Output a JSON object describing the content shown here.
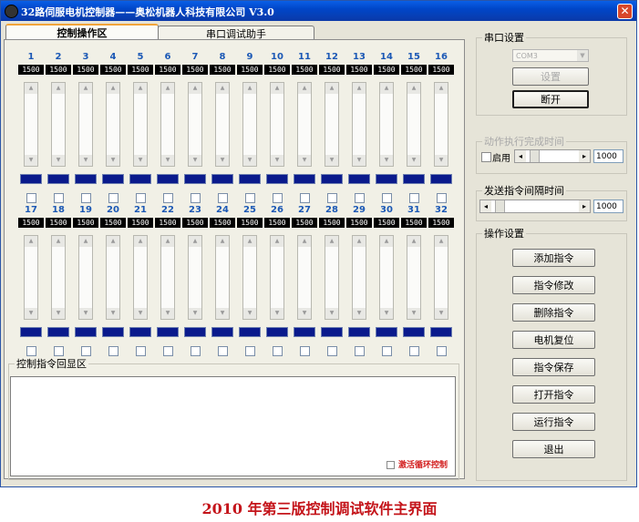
{
  "window": {
    "title": "32路伺服电机控制器——奥松机器人科技有限公司 V3.0"
  },
  "tabs": [
    {
      "label": "控制操作区"
    },
    {
      "label": "串口调试助手"
    }
  ],
  "channels_row1": [
    {
      "num": "1",
      "value": "1500"
    },
    {
      "num": "2",
      "value": "1500"
    },
    {
      "num": "3",
      "value": "1500"
    },
    {
      "num": "4",
      "value": "1500"
    },
    {
      "num": "5",
      "value": "1500"
    },
    {
      "num": "6",
      "value": "1500"
    },
    {
      "num": "7",
      "value": "1500"
    },
    {
      "num": "8",
      "value": "1500"
    },
    {
      "num": "9",
      "value": "1500"
    },
    {
      "num": "10",
      "value": "1500"
    },
    {
      "num": "11",
      "value": "1500"
    },
    {
      "num": "12",
      "value": "1500"
    },
    {
      "num": "13",
      "value": "1500"
    },
    {
      "num": "14",
      "value": "1500"
    },
    {
      "num": "15",
      "value": "1500"
    },
    {
      "num": "16",
      "value": "1500"
    }
  ],
  "channels_row2": [
    {
      "num": "17",
      "value": "1500"
    },
    {
      "num": "18",
      "value": "1500"
    },
    {
      "num": "19",
      "value": "1500"
    },
    {
      "num": "20",
      "value": "1500"
    },
    {
      "num": "21",
      "value": "1500"
    },
    {
      "num": "22",
      "value": "1500"
    },
    {
      "num": "23",
      "value": "1500"
    },
    {
      "num": "24",
      "value": "1500"
    },
    {
      "num": "25",
      "value": "1500"
    },
    {
      "num": "26",
      "value": "1500"
    },
    {
      "num": "27",
      "value": "1500"
    },
    {
      "num": "28",
      "value": "1500"
    },
    {
      "num": "29",
      "value": "1500"
    },
    {
      "num": "30",
      "value": "1500"
    },
    {
      "num": "31",
      "value": "1500"
    },
    {
      "num": "32",
      "value": "1500"
    }
  ],
  "echo": {
    "legend": "控制指令回显区",
    "loop_label": "激活循环控制"
  },
  "serial": {
    "legend": "串口设置",
    "port": "COM3",
    "settings_button": "设置",
    "disconnect_button": "断开"
  },
  "action_time": {
    "legend": "动作执行完成时间",
    "enable_label": "启用",
    "value": "1000"
  },
  "send_interval": {
    "legend": "发送指令间隔时间",
    "value": "1000"
  },
  "operations": {
    "legend": "操作设置",
    "buttons": [
      "添加指令",
      "指令修改",
      "删除指令",
      "电机复位",
      "指令保存",
      "打开指令",
      "运行指令",
      "退出"
    ]
  },
  "caption": "2010 年第三版控制调试软件主界面",
  "colors": {
    "title_bar": "#0046c8",
    "value_box": "#000000",
    "channel_bar": "#0a1a8c",
    "caption": "#c4141a"
  }
}
